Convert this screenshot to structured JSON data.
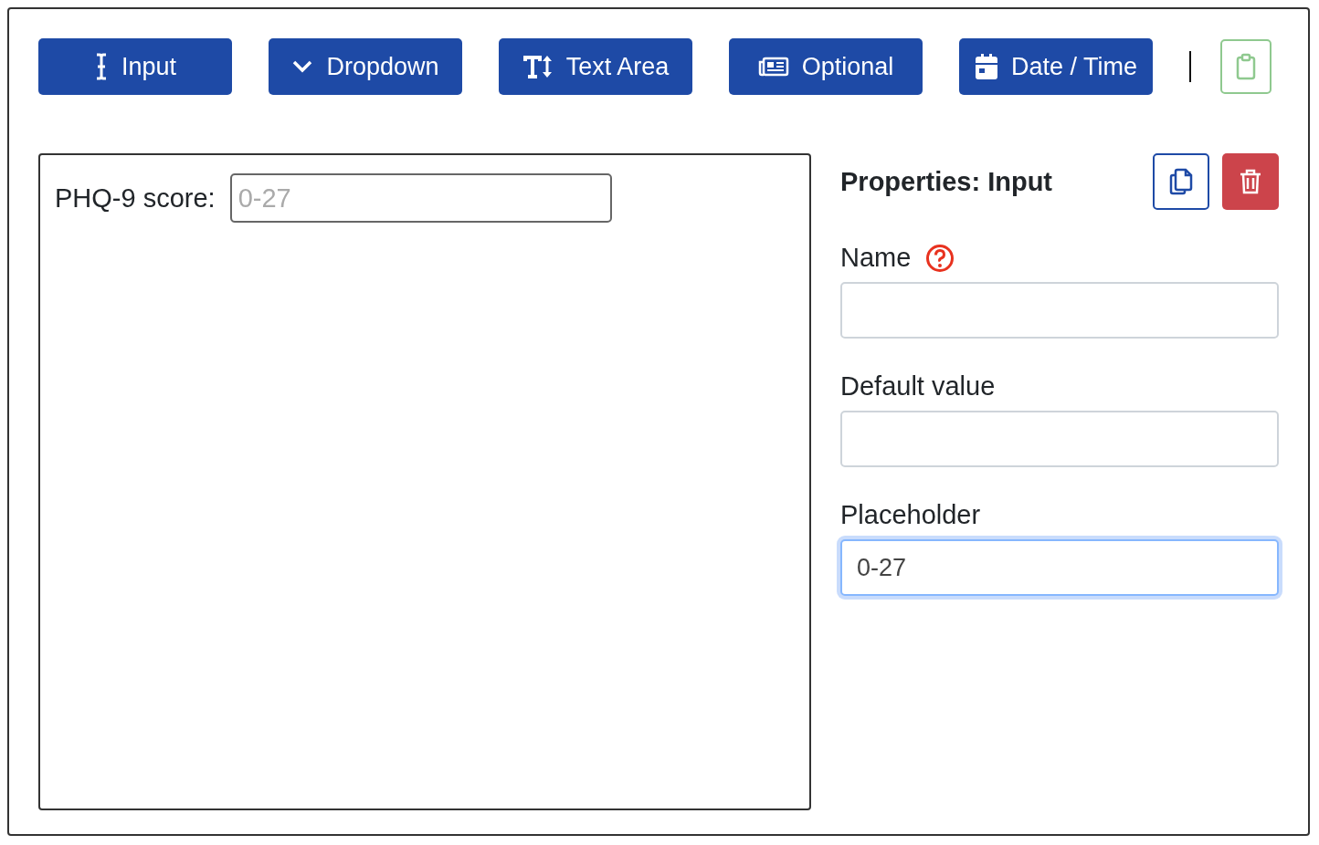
{
  "toolbar": {
    "buttons": [
      {
        "label": "Input",
        "kind": "input"
      },
      {
        "label": "Dropdown",
        "kind": "dropdown"
      },
      {
        "label": "Text Area",
        "kind": "textarea"
      },
      {
        "label": "Optional",
        "kind": "optional"
      },
      {
        "label": "Date / Time",
        "kind": "datetime"
      }
    ]
  },
  "canvas": {
    "fields": [
      {
        "label": "PHQ-9 score:",
        "placeholder": "0-27"
      }
    ]
  },
  "properties": {
    "title": "Properties: Input",
    "fields": [
      {
        "label": "Name",
        "help": true,
        "focused": false
      },
      {
        "label": "Default value",
        "help": false,
        "focused": false
      },
      {
        "label": "Placeholder",
        "value": "0-27",
        "help": false,
        "focused": true
      }
    ]
  }
}
